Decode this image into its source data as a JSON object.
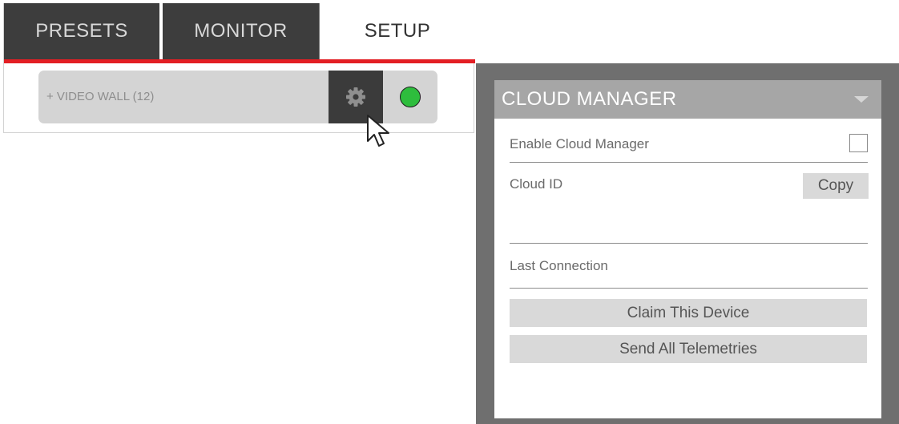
{
  "tabs": [
    {
      "label": "PRESETS",
      "active": false
    },
    {
      "label": "MONITOR",
      "active": false
    },
    {
      "label": "SETUP",
      "active": true
    }
  ],
  "video_wall": {
    "label": "+ VIDEO WALL (12)",
    "status": "online",
    "status_color": "#2ebd3d"
  },
  "cloud_manager": {
    "title": "CLOUD MANAGER",
    "enable_label": "Enable Cloud Manager",
    "enable_checked": false,
    "cloud_id_label": "Cloud ID",
    "cloud_id_value": "",
    "copy_label": "Copy",
    "last_connection_label": "Last Connection",
    "claim_label": "Claim This Device",
    "telemetry_label": "Send All Telemetries"
  },
  "colors": {
    "accent_red": "#e31e24",
    "tab_dark": "#3d3d3d",
    "window_frame": "#6f6f6f",
    "header_gray": "#a6a6a6"
  },
  "icons": [
    "gear-icon",
    "status-indicator",
    "mouse-pointer-icon",
    "chevron-down-icon"
  ]
}
